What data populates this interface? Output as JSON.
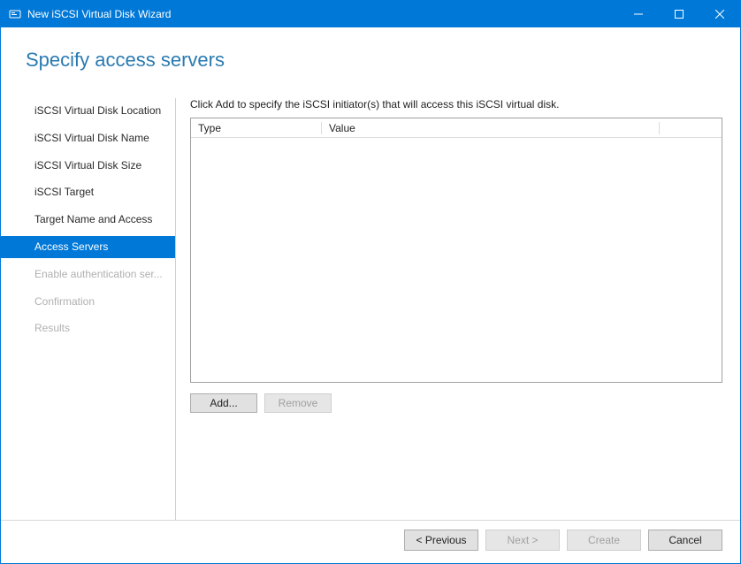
{
  "window": {
    "title": "New iSCSI Virtual Disk Wizard"
  },
  "page": {
    "heading": "Specify access servers"
  },
  "sidebar": {
    "items": [
      {
        "label": "iSCSI Virtual Disk Location",
        "state": "done"
      },
      {
        "label": "iSCSI Virtual Disk Name",
        "state": "done"
      },
      {
        "label": "iSCSI Virtual Disk Size",
        "state": "done"
      },
      {
        "label": "iSCSI Target",
        "state": "done"
      },
      {
        "label": "Target Name and Access",
        "state": "done"
      },
      {
        "label": "Access Servers",
        "state": "active"
      },
      {
        "label": "Enable authentication ser...",
        "state": "disabled"
      },
      {
        "label": "Confirmation",
        "state": "disabled"
      },
      {
        "label": "Results",
        "state": "disabled"
      }
    ]
  },
  "main": {
    "instruction": "Click Add to specify the iSCSI initiator(s) that will access this iSCSI virtual disk.",
    "columns": {
      "type": "Type",
      "value": "Value"
    },
    "add_label": "Add...",
    "remove_label": "Remove"
  },
  "footer": {
    "previous": "< Previous",
    "next": "Next >",
    "create": "Create",
    "cancel": "Cancel"
  }
}
